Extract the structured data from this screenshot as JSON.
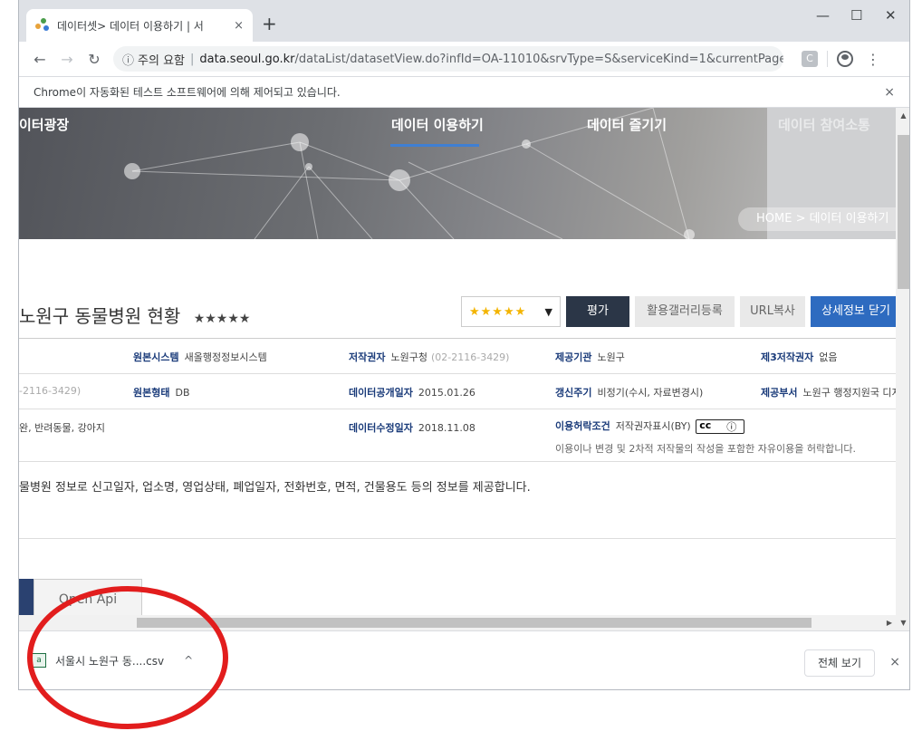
{
  "browser": {
    "tab_title": "데이터셋> 데이터 이용하기 | 서",
    "tab_close": "×",
    "new_tab": "+",
    "window_controls": {
      "minimize": "—",
      "maximize": "☐",
      "close": "✕"
    },
    "nav": {
      "back": "←",
      "forward": "→",
      "reload": "↻"
    },
    "omnibox": {
      "security_icon": "info-icon",
      "security_text": "주의 요함",
      "separator": "|",
      "host": "data.seoul.go.kr",
      "path": "/dataList/datasetView.do?infId=OA-11010&srvType=S&serviceKind=1&currentPageN...",
      "star": "☆"
    },
    "extension_label": "C",
    "menu": "⋮",
    "infobar_text": "Chrome이 자동화된 테스트 소프트웨어에 의해 제어되고 있습니다.",
    "infobar_close": "×"
  },
  "banner": {
    "site_name": "이터광장",
    "nav": [
      "데이터 이용하기",
      "데이터 즐기기",
      "데이터 참여소통"
    ],
    "breadcrumb": "HOME  >  데이터 이용하기"
  },
  "dataset": {
    "title": "노원구 동물병원 현황",
    "stars": "★★★★★",
    "rating_select_value": "★★★★★",
    "rating_arrow": "▼",
    "buttons": {
      "evaluate": "평가",
      "gallery": "활용갤러리등록",
      "url_copy": "URL복사",
      "close_detail": "상세정보 닫기"
    }
  },
  "info": {
    "row1": [
      {
        "label": "원본시스템",
        "value": "새올행정정보시스템"
      },
      {
        "label": "저작권자",
        "value": "노원구청",
        "extra": "(02-2116-3429)"
      },
      {
        "label": "제공기관",
        "value": "노원구"
      },
      {
        "label": "제3저작권자",
        "value": "없음"
      }
    ],
    "row2_left": "-2116-3429)",
    "row2": [
      {
        "label": "원본형태",
        "value": "DB"
      },
      {
        "label": "데이터공개일자",
        "value": "2015.01.26"
      },
      {
        "label": "갱신주기",
        "value": "비정기(수시, 자료변경시)"
      },
      {
        "label": "제공부서",
        "value": "노원구 행정지원국 디지"
      }
    ],
    "row3_left": "완, 반려동물, 강아지",
    "row3": [
      {
        "label": "데이터수정일자",
        "value": "2018.11.08"
      },
      {
        "label": "이용허락조건",
        "value": "저작권자표시(BY)",
        "sub": "이용이나 변경 및 2차적 저작물의 작성을 포함한 자유이용을 허락합니다."
      }
    ]
  },
  "description": "물병원 정보로 신고일자, 업소명, 영업상태, 폐업일자, 전화번호, 면적, 건물용도 등의 정보를 제공합니다.",
  "service_tab": "Open Api",
  "scrollbar": {
    "up": "▲",
    "down": "▼",
    "right": "▶"
  },
  "download_bar": {
    "file_icon": "csv-file-icon",
    "file_icon_glyph": "a",
    "file_name": "서울시 노원구 동....csv",
    "caret": "^",
    "show_all": "전체 보기",
    "close": "×"
  },
  "colors": {
    "annotation": "#e21d1d",
    "primary_button": "#2e6bc0",
    "dark_button": "#2b3647"
  }
}
